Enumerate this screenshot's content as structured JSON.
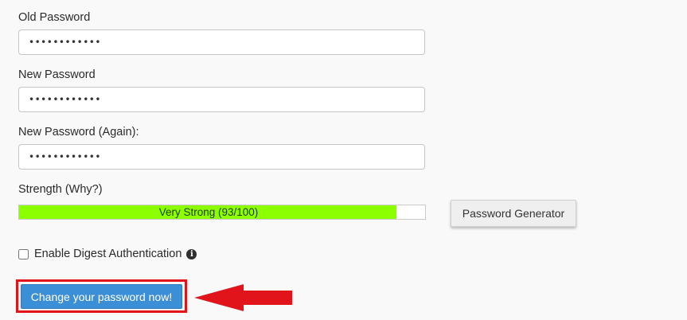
{
  "form": {
    "old_password": {
      "label": "Old Password",
      "value": "••••••••••••"
    },
    "new_password": {
      "label": "New Password",
      "value": "••••••••••••"
    },
    "new_password_again": {
      "label": "New Password (Again):",
      "value": "••••••••••••"
    },
    "strength": {
      "label": "Strength (Why?)",
      "text": "Very Strong (93/100)",
      "score": 93,
      "max": 100,
      "color": "#8cff00"
    },
    "generator_button": "Password Generator",
    "digest_auth": {
      "label": "Enable Digest Authentication",
      "checked": false,
      "info_icon": "info-circle-icon"
    },
    "submit_button": "Change your password now!"
  },
  "annotation": {
    "highlight_color": "#e0141a",
    "arrow_icon": "left-arrow-icon"
  }
}
